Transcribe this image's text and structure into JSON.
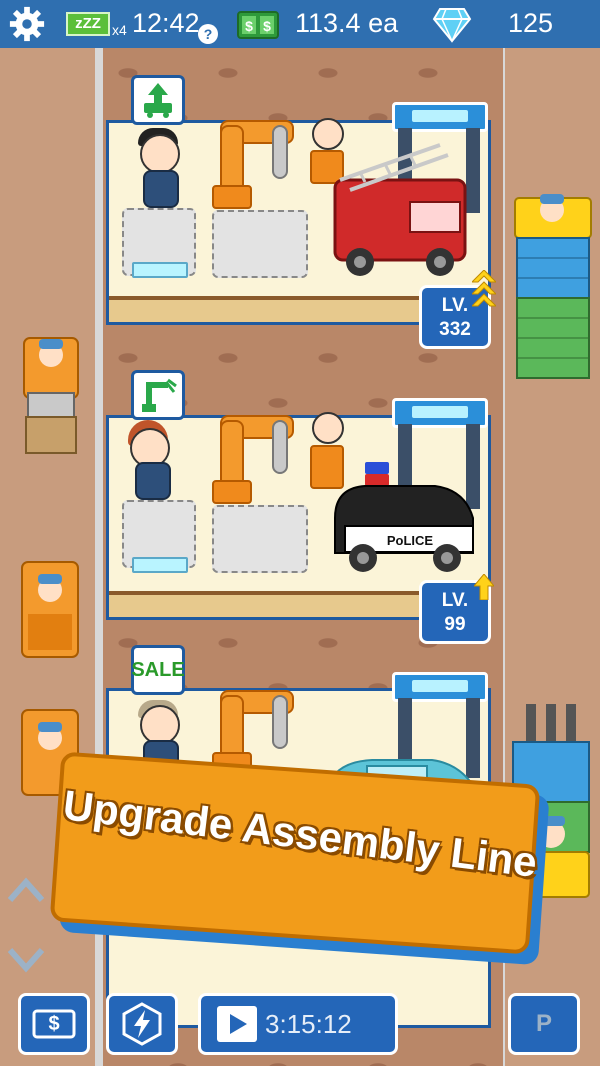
{
  "hud": {
    "sleep_label": "zZZ",
    "sleep_multiplier": "x4",
    "time": "12:42",
    "help_glyph": "?",
    "cash_amount": "113.4 ea",
    "gems_amount": "125",
    "icons": [
      "gear-icon",
      "zzz-icon",
      "question-icon",
      "cash-icon",
      "diamond-icon"
    ]
  },
  "lines": [
    {
      "badge": "upgrade-truck",
      "level_label": "LV.",
      "level_value": "332",
      "vehicle": "fire-truck"
    },
    {
      "badge": "robot-arm-upgrade",
      "level_label": "LV.",
      "level_value": "99",
      "vehicle": "police-car",
      "vehicle_text": "PoLICE"
    },
    {
      "badge_text": "SALE",
      "vehicle": "pickup-truck"
    }
  ],
  "banner": {
    "text": "Upgrade Assembly Line"
  },
  "bottom": {
    "cash_button_glyph": "$",
    "boost_icon": "lightning-icon",
    "video_timer": "3:15:12",
    "right_button_glyph": "P"
  },
  "colors": {
    "hud_blue": "#2f6fb0",
    "panel_border": "#1e5aa0",
    "banner_orange": "#f29c1a",
    "road": "#c89c7e"
  }
}
